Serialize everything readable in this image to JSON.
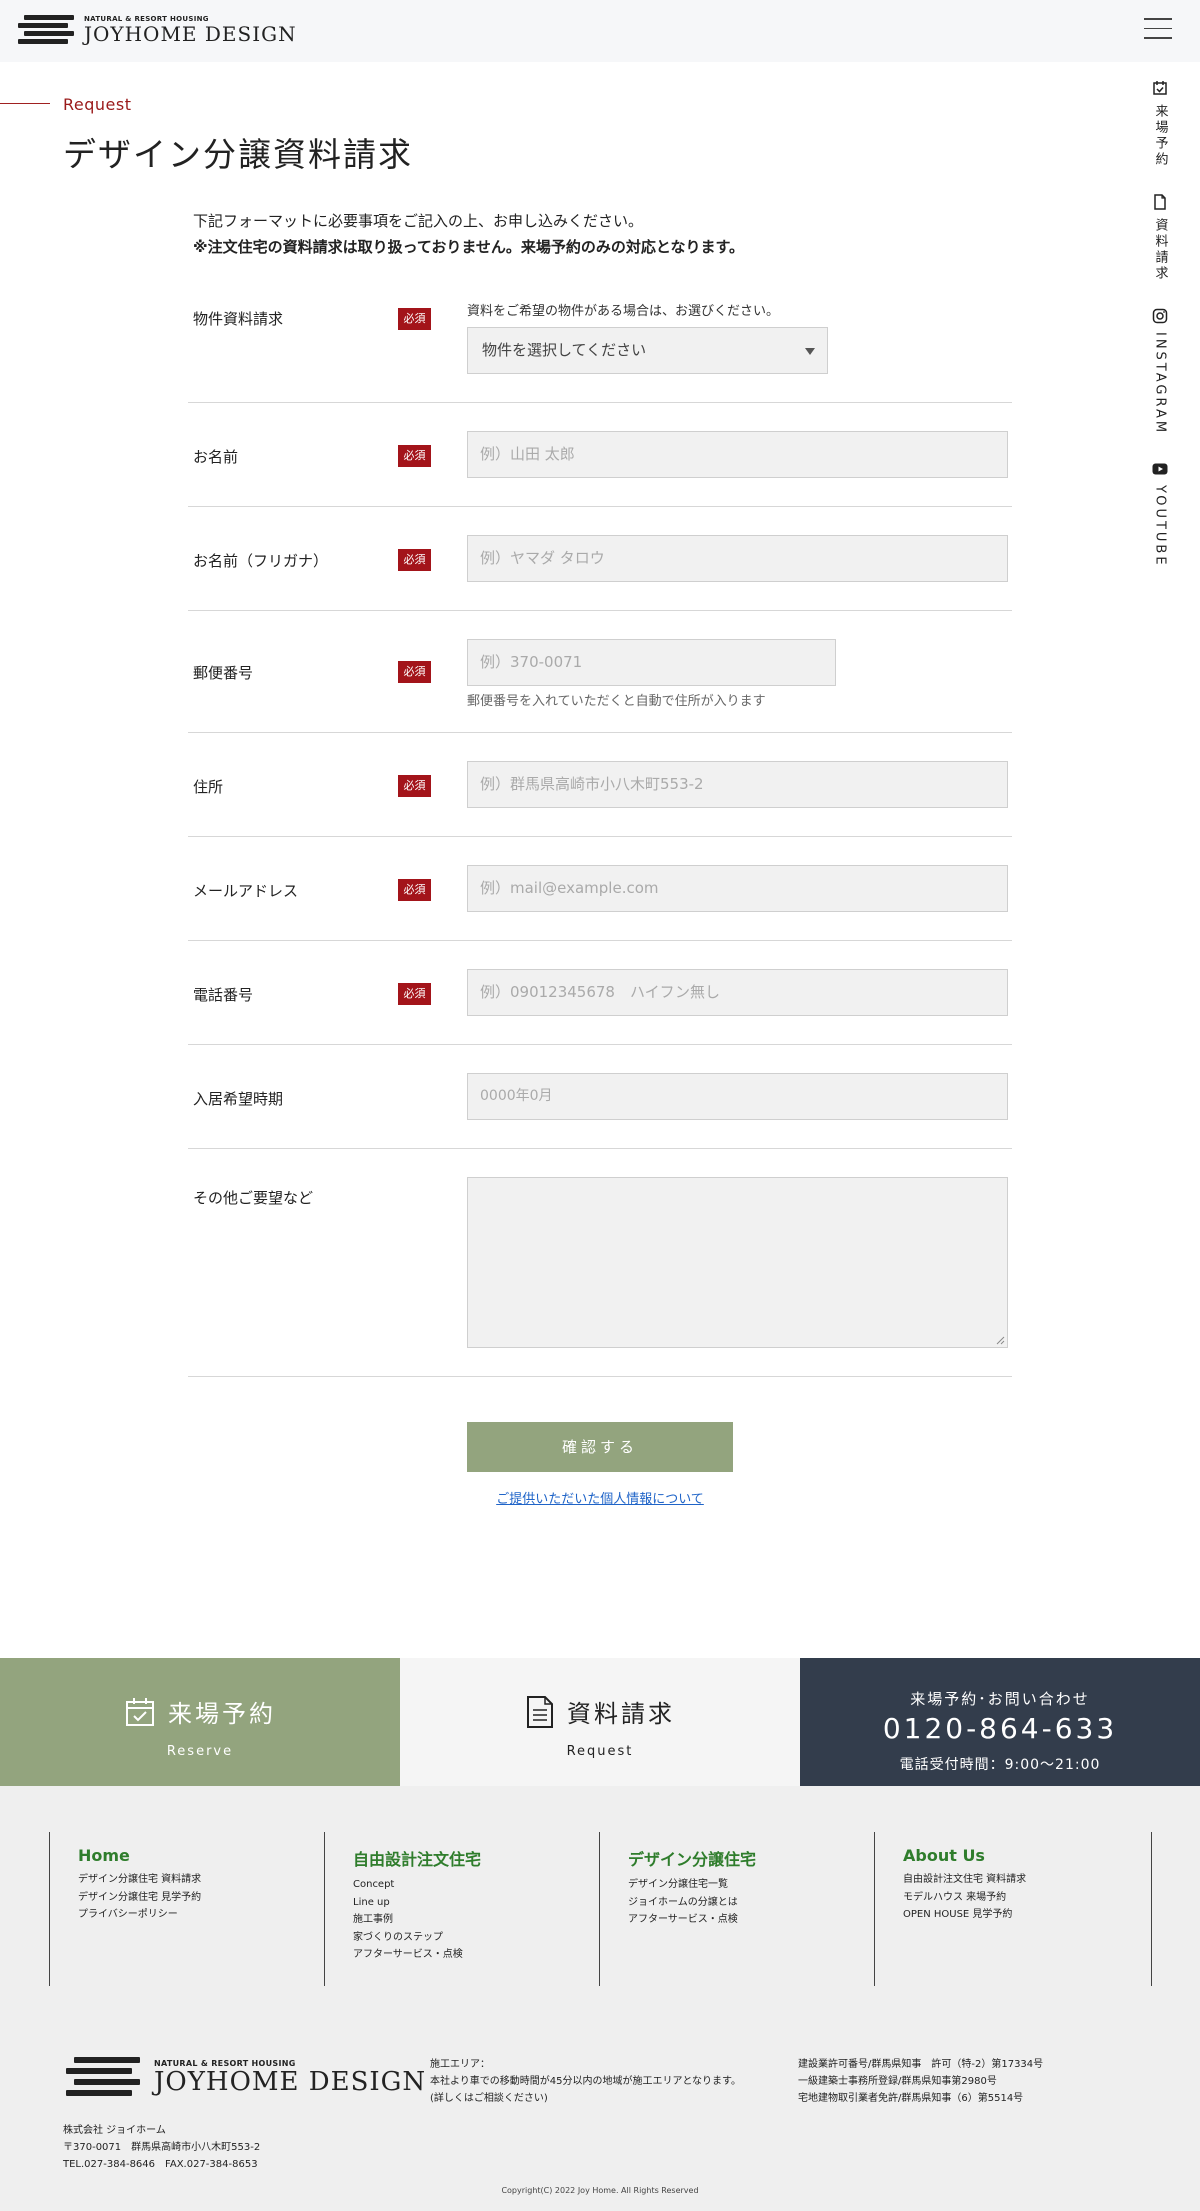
{
  "header": {
    "logo_small": "NATURAL & RESORT HOUSING",
    "logo_big": "JOYHOME DESIGN"
  },
  "sidenav": {
    "items": [
      {
        "label": "来場予約",
        "icon": "calendar-check-icon"
      },
      {
        "label": "資料請求",
        "icon": "document-icon"
      },
      {
        "label": "INSTAGRAM",
        "icon": "instagram-icon"
      },
      {
        "label": "YOUTUBE",
        "icon": "youtube-icon"
      }
    ]
  },
  "page": {
    "eyebrow": "Request",
    "title": "デザイン分譲資料請求",
    "intro": "下記フォーマットに必要事項をご記入の上、お申し込みください。",
    "intro_note": "※注文住宅の資料請求は取り扱っておりません。来場予約のみの対応となります。"
  },
  "form": {
    "required_badge": "必須",
    "property": {
      "label": "物件資料請求",
      "note": "資料をご希望の物件がある場合は、お選びください。",
      "selected": "物件を選択してください"
    },
    "name": {
      "label": "お名前",
      "placeholder": "例）山田 太郎"
    },
    "kana": {
      "label": "お名前（フリガナ）",
      "placeholder": "例）ヤマダ タロウ"
    },
    "zip": {
      "label": "郵便番号",
      "placeholder": "例）370-0071",
      "note": "郵便番号を入れていただくと自動で住所が入ります"
    },
    "address": {
      "label": "住所",
      "placeholder": "例）群馬県高崎市小八木町553-2"
    },
    "email": {
      "label": "メールアドレス",
      "placeholder": "例）mail@example.com"
    },
    "phone": {
      "label": "電話番号",
      "placeholder": "例）09012345678　ハイフン無し"
    },
    "move_in": {
      "label": "入居希望時期",
      "placeholder": "0000年0月"
    },
    "other": {
      "label": "その他ご要望など"
    },
    "submit": "確認する",
    "privacy": "ご提供いただいた個人情報について"
  },
  "cta": {
    "reserve": {
      "title": "来場予約",
      "sub": "Reserve"
    },
    "request": {
      "title": "資料請求",
      "sub": "Request"
    },
    "contact": {
      "top": "来場予約･お問い合わせ",
      "phone": "0120-864-633",
      "hours": "電話受付時間：9:00～21:00"
    }
  },
  "footer": {
    "columns": [
      {
        "head": "Home",
        "links": [
          "デザイン分譲住宅 資料請求",
          "デザイン分譲住宅 見学予約",
          "プライバシーポリシー"
        ]
      },
      {
        "head": "自由設計注文住宅",
        "links": [
          "Concept",
          "Line up",
          "施工事例",
          "家づくりのステップ",
          "アフターサービス・点検"
        ]
      },
      {
        "head": "デザイン分譲住宅",
        "links": [
          "デザイン分譲住宅一覧",
          "ジョイホームの分譲とは",
          "アフターサービス・点検"
        ]
      },
      {
        "head": "About Us",
        "links": [
          "自由設計注文住宅 資料請求",
          "モデルハウス 来場予約",
          "OPEN HOUSE 見学予約"
        ]
      }
    ],
    "area_lines": [
      "施工エリア：",
      "本社より車での移動時間が45分以内の地域が施工エリアとなります。",
      "(詳しくはご相談ください)"
    ],
    "license_lines": [
      "建設業許可番号/群馬県知事　許可（特-2）第17334号",
      "一級建築士事務所登録/群馬県知事第2980号",
      "宅地建物取引業者免許/群馬県知事（6）第5514号"
    ],
    "company_lines": [
      "株式会社 ジョイホーム",
      "〒370-0071　群馬県高崎市小八木町553-2",
      "TEL.027-384-8646　FAX.027-384-8653"
    ],
    "copyright": "Copyright(C) 2022 Joy Home. All Rights Reserved"
  },
  "colors": {
    "accent_red": "#a3141a",
    "sage": "#93a47e",
    "navy": "#333d4c",
    "footer_green": "#2f7d2c"
  }
}
